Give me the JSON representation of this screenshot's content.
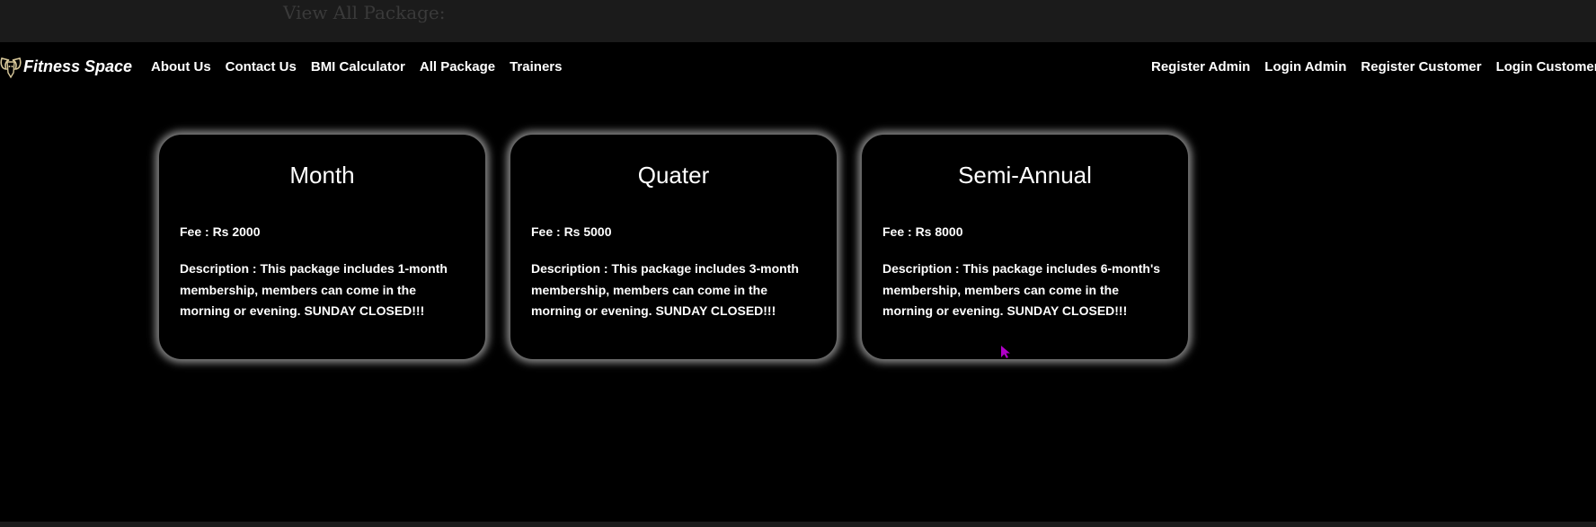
{
  "page": {
    "heading": "View All Package:"
  },
  "navbar": {
    "brand": "Fitness Space",
    "brand_icon": "ram-head-logo",
    "left_links": [
      "About Us",
      "Contact Us",
      "BMI Calculator",
      "All Package",
      "Trainers"
    ],
    "right_links": [
      "Register Admin",
      "Login Admin",
      "Register Customer",
      "Login Customer"
    ]
  },
  "packages": [
    {
      "title": "Month",
      "fee": "Fee : Rs 2000",
      "description": "Description : This package includes 1-month membership, members can come in the morning or evening. SUNDAY CLOSED!!!"
    },
    {
      "title": "Quater",
      "fee": "Fee : Rs 5000",
      "description": "Description : This package includes 3-month membership, members can come in the morning or evening. SUNDAY CLOSED!!!"
    },
    {
      "title": "Semi-Annual",
      "fee": "Fee : Rs 8000",
      "description": "Description : This package includes 6-month's membership, members can come in the morning or evening. SUNDAY CLOSED!!!"
    }
  ],
  "colors": {
    "background": "#000000",
    "topbar": "#1b1b1b",
    "text": "#ffffff",
    "card_glow": "#ffffff",
    "cursor": "#b000c8"
  }
}
